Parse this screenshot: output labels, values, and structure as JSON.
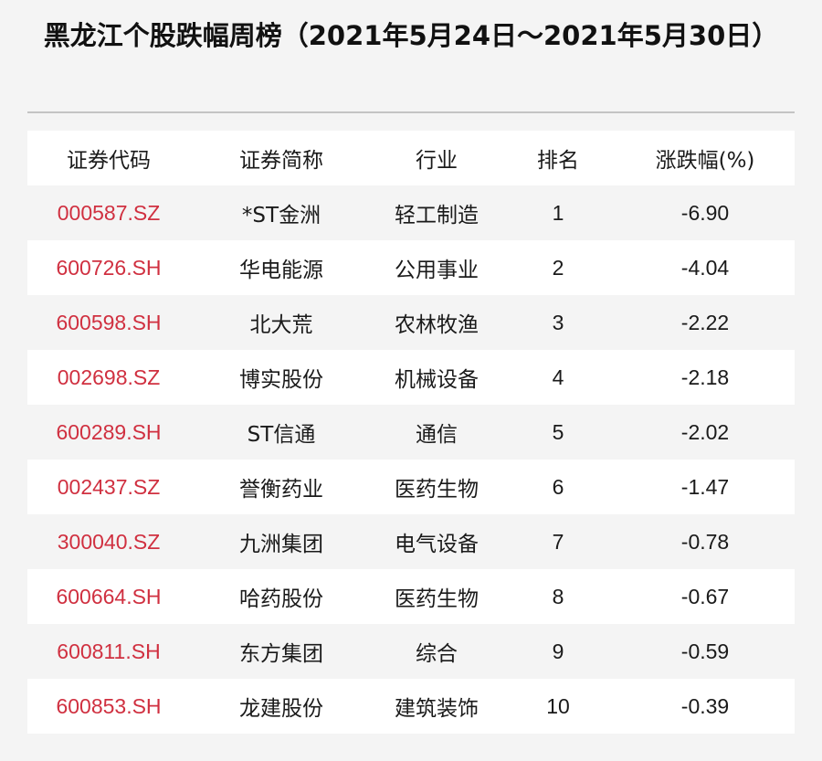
{
  "title": "黑龙江个股跌幅周榜（2021年5月24日～2021年5月30日）",
  "table": {
    "headers": [
      "证券代码",
      "证券简称",
      "行业",
      "排名",
      "涨跌幅(%)"
    ],
    "rows": [
      [
        "000587.SZ",
        "*ST金洲",
        "轻工制造",
        "1",
        "-6.90"
      ],
      [
        "600726.SH",
        "华电能源",
        "公用事业",
        "2",
        "-4.04"
      ],
      [
        "600598.SH",
        "北大荒",
        "农林牧渔",
        "3",
        "-2.22"
      ],
      [
        "002698.SZ",
        "博实股份",
        "机械设备",
        "4",
        "-2.18"
      ],
      [
        "600289.SH",
        "ST信通",
        "通信",
        "5",
        "-2.02"
      ],
      [
        "002437.SZ",
        "誉衡药业",
        "医药生物",
        "6",
        "-1.47"
      ],
      [
        "300040.SZ",
        "九洲集团",
        "电气设备",
        "7",
        "-0.78"
      ],
      [
        "600664.SH",
        "哈药股份",
        "医药生物",
        "8",
        "-0.67"
      ],
      [
        "600811.SH",
        "东方集团",
        "综合",
        "9",
        "-0.59"
      ],
      [
        "600853.SH",
        "龙建股份",
        "建筑装饰",
        "10",
        "-0.39"
      ]
    ]
  },
  "colors": {
    "code_text": "#d03040",
    "row_white": "#ffffff",
    "row_grey": "#f4f4f4"
  }
}
